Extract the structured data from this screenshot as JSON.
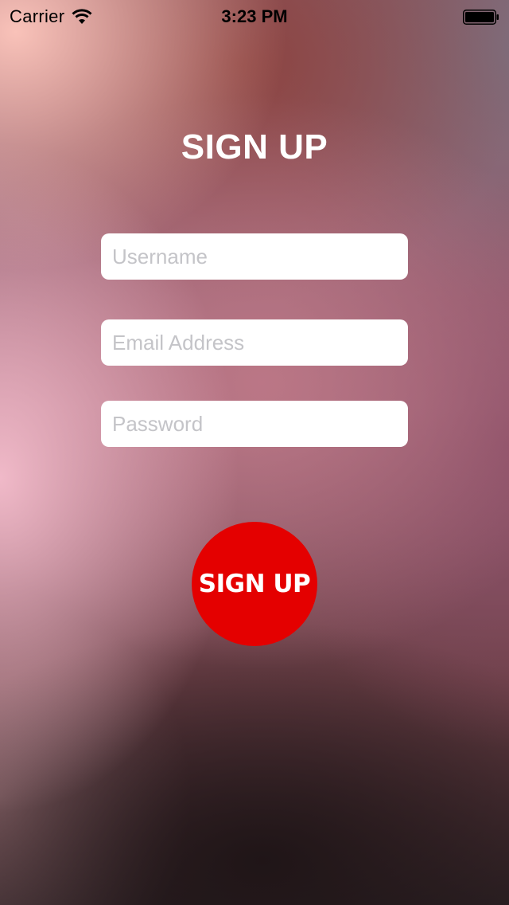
{
  "status_bar": {
    "carrier": "Carrier",
    "time": "3:23 PM",
    "wifi_icon": "wifi-icon",
    "battery_icon": "battery-icon"
  },
  "title": "SIGN UP",
  "form": {
    "username": {
      "placeholder": "Username",
      "value": ""
    },
    "email": {
      "placeholder": "Email Address",
      "value": ""
    },
    "password": {
      "placeholder": "Password",
      "value": ""
    }
  },
  "signup_button": {
    "label": "SIGN UP",
    "color": "#e40000"
  }
}
